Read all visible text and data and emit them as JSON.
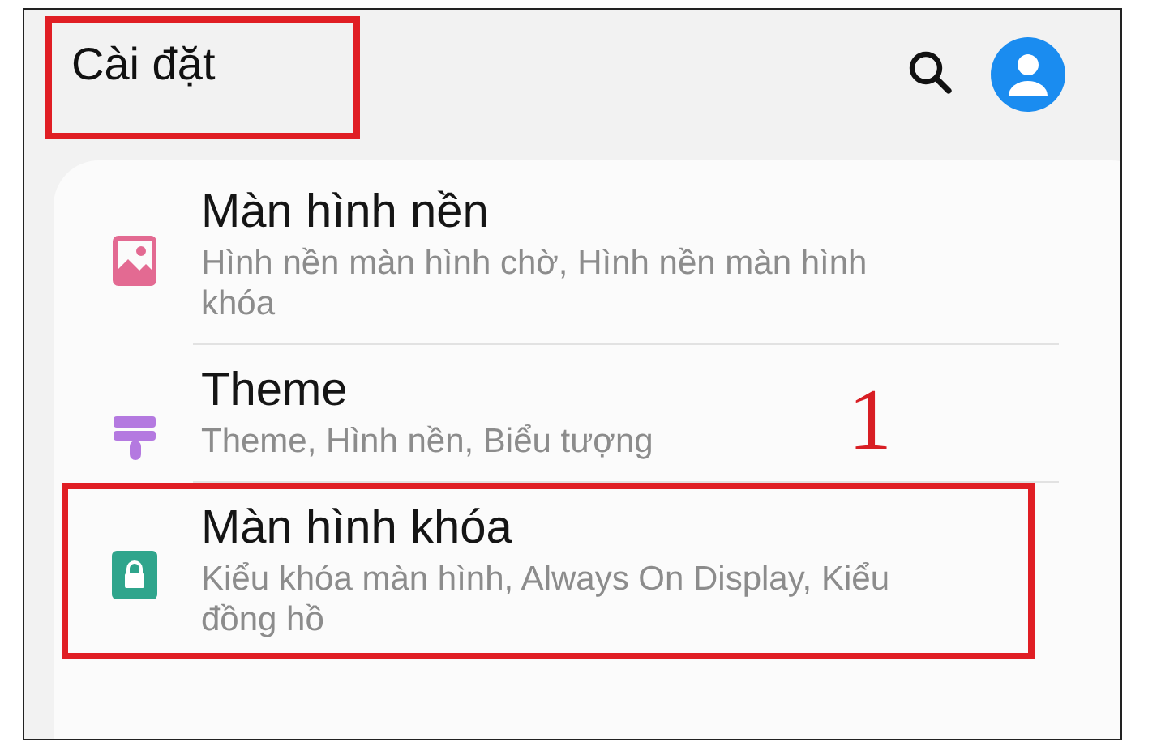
{
  "header": {
    "title": "Cài đặt",
    "highlighted": true
  },
  "settings": [
    {
      "kind": "image",
      "color": "#e36a92",
      "title": "Màn hình nền",
      "subtitle": "Hình nền màn hình chờ, Hình nền màn hình khóa",
      "highlighted": false
    },
    {
      "kind": "brush",
      "color": "#b479e0",
      "title": "Theme",
      "subtitle": "Theme, Hình nền, Biểu tượng",
      "highlighted": false
    },
    {
      "kind": "lock",
      "color": "#2fa58c",
      "title": "Màn hình khóa",
      "subtitle": "Kiểu khóa màn hình, Always On Display, Kiểu đồng hồ",
      "highlighted": true
    }
  ],
  "annotation": "1"
}
